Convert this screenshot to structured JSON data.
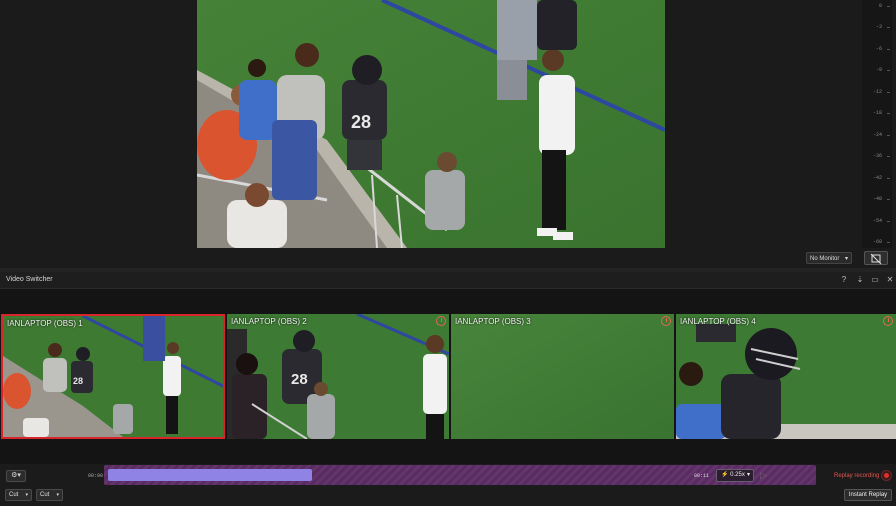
{
  "program_monitor": {
    "monitor_select": "No Monitor",
    "vu_ticks": [
      "0",
      "-3",
      "-6",
      "-9",
      "-12",
      "-18",
      "-24",
      "-36",
      "-42",
      "-48",
      "-54",
      "-60"
    ]
  },
  "switcher": {
    "title": "Video Switcher",
    "header_icons": [
      "help-icon",
      "pin-icon",
      "float-icon",
      "close-icon"
    ],
    "tiles": [
      {
        "label": "IANLAPTOP (OBS) 1",
        "active": true,
        "has_clock": false
      },
      {
        "label": "IANLAPTOP (OBS) 2",
        "active": false,
        "has_clock": true
      },
      {
        "label": "IANLAPTOP (OBS) 3",
        "active": false,
        "has_clock": true
      },
      {
        "label": "IANLAPTOP (OBS) 4",
        "active": false,
        "has_clock": true
      }
    ]
  },
  "replay": {
    "time_start": "00:00",
    "time_end": "00:11",
    "speed": "0.25x",
    "progress": 0.29,
    "status": "Replay recording",
    "instant_label": "Instant Replay"
  },
  "transitions": {
    "left": "Cut",
    "right": "Cut"
  },
  "colors": {
    "active_border": "#d8252b",
    "timeline": "#5a2a63",
    "timeline_fill": "#8f83e6",
    "recording": "#e0302c"
  }
}
